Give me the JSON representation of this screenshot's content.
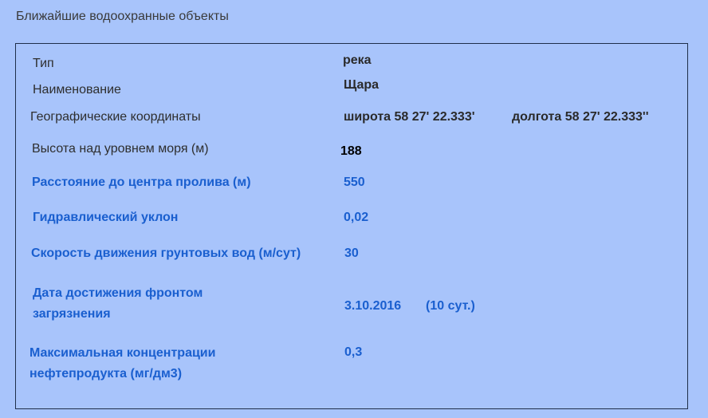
{
  "section": {
    "title": "Ближайшие водоохранные объекты"
  },
  "object": {
    "type": {
      "label": "Тип",
      "value": "река"
    },
    "name": {
      "label": "Наименование",
      "value": "Щара"
    },
    "coordinates": {
      "label": "Географические координаты",
      "latitude": "широта 58 27' 22.333'",
      "longitude": "долгота 58 27' 22.333''"
    },
    "altitude": {
      "label": "Высота над уровнем моря (м)",
      "value": "188"
    },
    "distance": {
      "label": "Расстояние до центра пролива (м)",
      "value": "550"
    },
    "slope": {
      "label": "Гидравлический уклон",
      "value": "0,02"
    },
    "groundwater_speed": {
      "label": "Скорость движения грунтовых вод (м/сут)",
      "value": "30"
    },
    "front_date": {
      "label_line1": "Дата  достижения фронтом",
      "label_line2": "загрязнения",
      "date": "3.10.2016",
      "days": "(10 сут.)"
    },
    "max_concentration": {
      "label_line1": "Максимальная концентрации",
      "label_line2": "нефтепродукта  (мг/дм3)",
      "value": "0,3"
    }
  }
}
